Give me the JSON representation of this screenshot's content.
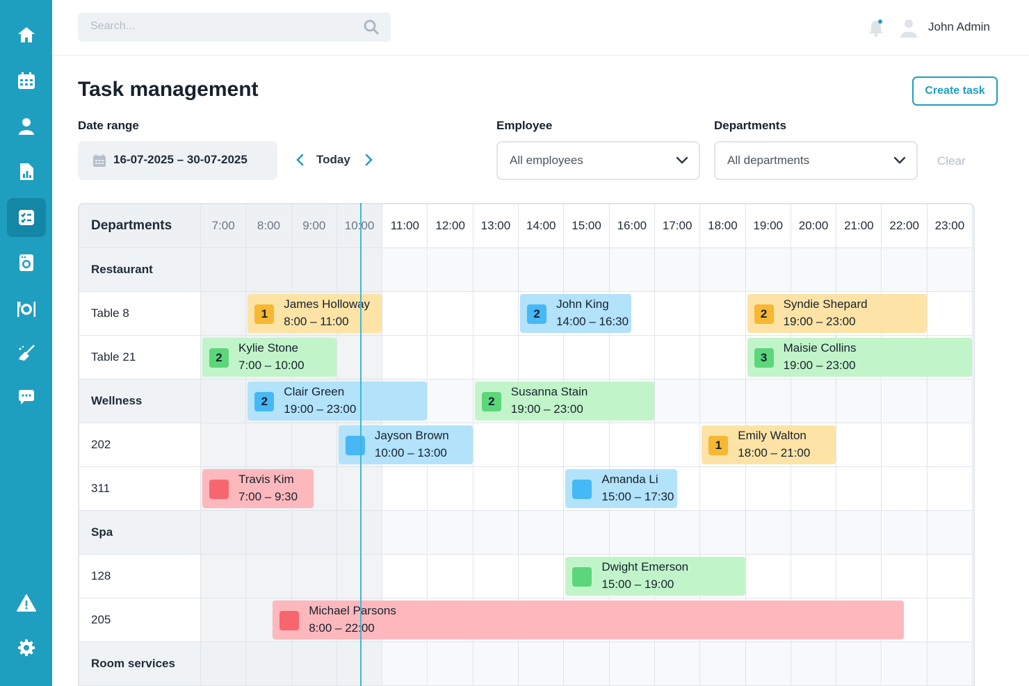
{
  "topbar": {
    "search_placeholder": "Search...",
    "user_name": "John Admin"
  },
  "page": {
    "title": "Task management",
    "create_label": "Create task"
  },
  "filters": {
    "date_label": "Date range",
    "date_value": "16-07-2025 – 30-07-2025",
    "today_label": "Today",
    "employee_label": "Employee",
    "employee_value": "All employees",
    "departments_label": "Departments",
    "departments_value": "All departments",
    "clear_label": "Clear"
  },
  "schedule": {
    "header_label": "Departments",
    "hours": [
      "7:00",
      "8:00",
      "9:00",
      "10:00",
      "11:00",
      "12:00",
      "13:00",
      "14:00",
      "15:00",
      "16:00",
      "17:00",
      "18:00",
      "19:00",
      "20:00",
      "21:00",
      "22:00",
      "23:00"
    ],
    "past_hour_count": 4,
    "current_time": 10.5,
    "rows": [
      {
        "label": "Restaurant",
        "group": true
      },
      {
        "label": "Table 8",
        "group": false
      },
      {
        "label": "Table 21",
        "group": false
      },
      {
        "label": "Wellness",
        "group": true
      },
      {
        "label": "202",
        "group": false
      },
      {
        "label": "311",
        "group": false
      },
      {
        "label": "Spa",
        "group": true
      },
      {
        "label": "128",
        "group": false
      },
      {
        "label": "205",
        "group": false
      },
      {
        "label": "Room services",
        "group": true
      }
    ],
    "tasks": [
      {
        "row": 1,
        "start": 8,
        "end": 11,
        "name": "James Holloway",
        "time": "8:00 – 11:00",
        "badge": "1",
        "color": "yellow"
      },
      {
        "row": 1,
        "start": 14,
        "end": 16.5,
        "name": "John King",
        "time": "14:00 – 16:30",
        "badge": "2",
        "color": "blue"
      },
      {
        "row": 1,
        "start": 19,
        "end": 23,
        "name": "Syndie Shepard",
        "time": "19:00 – 23:00",
        "badge": "2",
        "color": "yellow"
      },
      {
        "row": 2,
        "start": 7,
        "end": 10,
        "name": "Kylie Stone",
        "time": "7:00 – 10:00",
        "badge": "2",
        "color": "green"
      },
      {
        "row": 2,
        "start": 19,
        "end": 24,
        "name": "Maisie Collins",
        "time": "19:00 – 23:00",
        "badge": "3",
        "color": "green"
      },
      {
        "row": 3,
        "start": 8,
        "end": 12,
        "name": "Clair Green",
        "time": "19:00 – 23:00",
        "badge": "2",
        "color": "blue"
      },
      {
        "row": 3,
        "start": 13,
        "end": 17,
        "name": "Susanna Stain",
        "time": "19:00 – 23:00",
        "badge": "2",
        "color": "green"
      },
      {
        "row": 4,
        "start": 10,
        "end": 13,
        "name": "Jayson Brown",
        "time": "10:00 – 13:00",
        "badge": "",
        "color": "blue"
      },
      {
        "row": 4,
        "start": 18,
        "end": 21,
        "name": "Emily Walton",
        "time": "18:00 – 21:00",
        "badge": "1",
        "color": "yellow"
      },
      {
        "row": 5,
        "start": 7,
        "end": 9.5,
        "name": "Travis Kim",
        "time": "7:00 – 9:30",
        "badge": "",
        "color": "red"
      },
      {
        "row": 5,
        "start": 15,
        "end": 17.5,
        "name": "Amanda Li",
        "time": "15:00 – 17:30",
        "badge": "",
        "color": "blue"
      },
      {
        "row": 7,
        "start": 15,
        "end": 19,
        "name": "Dwight Emerson",
        "time": "15:00 – 19:00",
        "badge": "",
        "color": "green"
      },
      {
        "row": 8,
        "start": 8.55,
        "end": 22.5,
        "name": "Michael Parsons",
        "time": "8:00 – 22:00",
        "badge": "",
        "color": "red"
      }
    ]
  },
  "nav": [
    {
      "icon": "home-icon"
    },
    {
      "icon": "calendar-icon"
    },
    {
      "icon": "user-icon"
    },
    {
      "icon": "report-icon"
    },
    {
      "icon": "tasks-icon",
      "active": true
    },
    {
      "icon": "laundry-icon"
    },
    {
      "icon": "dining-icon"
    },
    {
      "icon": "cleaning-icon"
    },
    {
      "icon": "chat-icon"
    },
    {
      "icon": "alert-icon"
    },
    {
      "icon": "settings-icon"
    }
  ]
}
